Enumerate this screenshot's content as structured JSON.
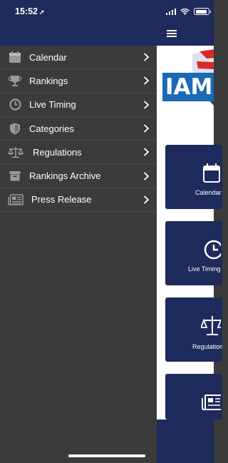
{
  "status_bar": {
    "time": "15:52",
    "location_glyph": "➚"
  },
  "menu": {
    "items": [
      {
        "label": "Calendar",
        "icon": "calendar-icon"
      },
      {
        "label": "Rankings",
        "icon": "trophy-icon"
      },
      {
        "label": "Live Timing",
        "icon": "clock-icon"
      },
      {
        "label": "Categories",
        "icon": "shield-icon"
      },
      {
        "label": "Regulations",
        "icon": "scales-icon"
      },
      {
        "label": "Rankings Archive",
        "icon": "archive-icon"
      },
      {
        "label": "Press Release",
        "icon": "newspaper-icon"
      }
    ]
  },
  "content": {
    "logo_text": "IAM",
    "tiles": [
      {
        "label": "Calendar",
        "icon": "calendar-icon"
      },
      {
        "label": "Live Timing",
        "icon": "clock-icon"
      },
      {
        "label": "Regulations",
        "icon": "scales-icon"
      },
      {
        "label": "",
        "icon": "newspaper-icon"
      }
    ]
  },
  "colors": {
    "header_navy": "#1d2a5b",
    "drawer_bg": "#3b3b3b",
    "logo_blue": "#1a69b8",
    "icon_gray": "#9a9a9a"
  }
}
